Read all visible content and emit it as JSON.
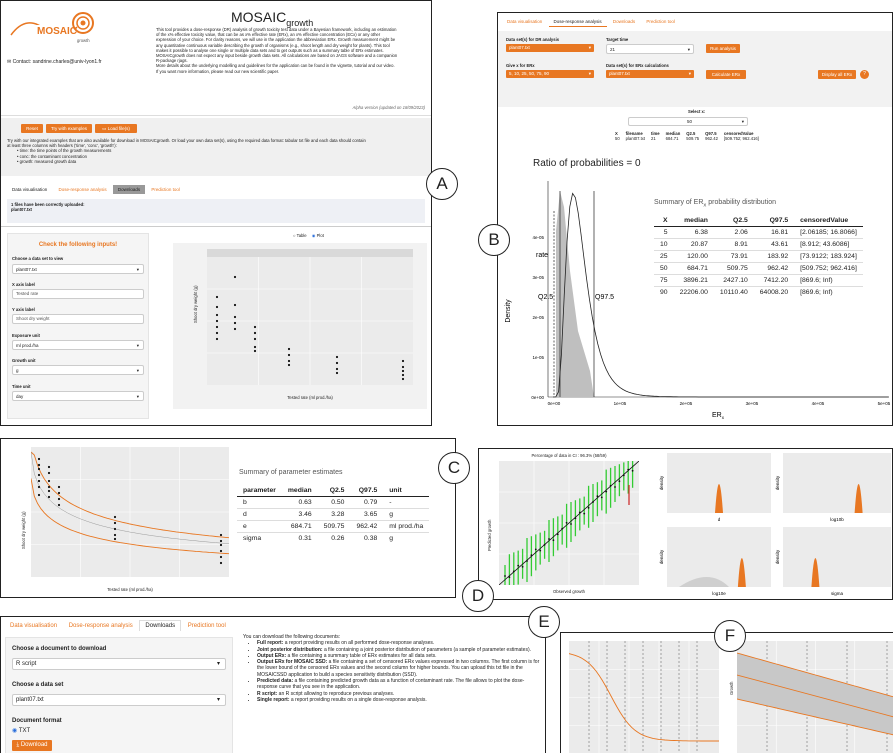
{
  "labels": {
    "a": "A",
    "b": "B",
    "c": "C",
    "d": "D",
    "e": "E",
    "f": "F"
  },
  "panelA": {
    "title": "MOSAIC",
    "title_sub": "growth",
    "logo_text": "MOSAIC",
    "logo_sub": "growth",
    "contact": "Contact: sandrine.charles@univ-lyon1.fr",
    "intro_lines": [
      "This tool provides a dose-response (DR) analysis of growth toxicity test data under a Bayesian framework, including an estimation",
      "of the x% effective toxicity value, that can be as x% effective rate (ERx), an x% effective concentration (ECx) or any other",
      "expression of your choice. For clarity reasons, we will use in the application the abbreviation ERx. Growth measurement might be",
      "any quantitative continuous variable describing the growth of organisms (e.g., shoot length and dry weight for plants). This tool",
      "makes it possible to analyse one single or multiple data sets and to get outputs such as a summary table of ERx estimates.",
      "MOSAICgrowth does not expect any input beside growth data sets. All calculations are based on JAGS software and a companion",
      "R-package rjags.",
      "More details about the underlying modelling and guidelines for the application can be found in the vignette, tutorial and our video.",
      "If you want more information, please read our new scientific paper."
    ],
    "version": "Alpha version (updated on 18/09/2023)",
    "btn_reset": "Reset",
    "btn_examples": "Try with examples",
    "btn_load": "Load file(s)",
    "desc_lines": [
      "Try with our integrated examples that are also available for download in MOSAICgrowth. Or load your own data set(s), using the required data format: tabular txt file and each data should contain",
      "at least three columns with headers ('time', 'conc', 'growth'):"
    ],
    "bullets": [
      "time: the time points of the growth measurements",
      "conc: the contaminant concentration",
      "growth: measured growth data"
    ],
    "tabs": [
      "Data visualisation",
      "Dose-response analysis",
      "Downloads",
      "Prediction tool"
    ],
    "upload_msg": "1 files have been correctly uploaded:",
    "upload_file": "plant07.txt",
    "check_title": "Check the following inputs!",
    "fields": [
      {
        "label": "Choose a data set to view",
        "value": "plant07.txt"
      },
      {
        "label": "X axis label",
        "value": "Tested rate"
      },
      {
        "label": "Y axis label",
        "value": "Shoot dry weight"
      },
      {
        "label": "Exposure unit",
        "value": "ml prod./ha"
      },
      {
        "label": "Growth unit",
        "value": "g"
      },
      {
        "label": "Time unit",
        "value": "day"
      }
    ],
    "radio_table": "Table",
    "radio_plot": "Plot",
    "plot_strip": "time 21 (day)",
    "plot_xlabel": "Tested rate (ml prod./ha)",
    "plot_ylabel": "Shoot dry weight (g)"
  },
  "panelB": {
    "tabs": [
      "Data visualisation",
      "Dose-response analysis",
      "Downloads",
      "Prediction tool"
    ],
    "ds_label": "Data set(s) for DR analysis",
    "ds_value": "plant07.txt",
    "target_label": "Target time",
    "target_value": "21",
    "run_btn": "Run analysis",
    "x_label": "Give x for ERx",
    "x_value": "5, 10, 25, 50, 75, 90",
    "ds2_label": "Data set(s) for ERx calculations",
    "ds2_value": "plant07.txt",
    "calc_btn": "Calculate ERx",
    "display_btn": "Display all ERx",
    "select_label": "Select x:",
    "select_value": "50",
    "mini_headers": [
      "X",
      "filename",
      "time",
      "median",
      "Q2.5",
      "Q97.5",
      "censoredValue"
    ],
    "mini_row": [
      "50",
      "plant07.txt",
      "21",
      "684.71",
      "509.75",
      "962.42",
      "[509.752; 962.416]"
    ],
    "plot_title": "Ratio of probabilities = 0",
    "rate_label": "rate",
    "q25_label": "Q2.5",
    "q975_label": "Q97.5",
    "ylabel": "Density",
    "xlabel": "ERx",
    "yticks": [
      "0e+00",
      "1e-05",
      "2e-05",
      "3e-05",
      "4e-05"
    ],
    "xticks": [
      "0e+00",
      "1e+05",
      "2e+05",
      "3e+05",
      "4e+05",
      "5e+05"
    ],
    "summary_title": "Summary of ERx probability distribution",
    "summary_headers": [
      "X",
      "median",
      "Q2.5",
      "Q97.5",
      "censoredValue"
    ],
    "summary_rows": [
      [
        "5",
        "6.38",
        "2.06",
        "16.81",
        "[2.06185; 16.8066]"
      ],
      [
        "10",
        "20.87",
        "8.91",
        "43.61",
        "[8.912; 43.6086]"
      ],
      [
        "25",
        "120.00",
        "73.91",
        "183.92",
        "[73.9122; 183.924]"
      ],
      [
        "50",
        "684.71",
        "509.75",
        "962.42",
        "[509.752; 962.416]"
      ],
      [
        "75",
        "3896.21",
        "2427.10",
        "7412.20",
        "[869.6; Inf)"
      ],
      [
        "90",
        "22206.00",
        "10110.40",
        "64008.20",
        "[869.6; Inf)"
      ]
    ]
  },
  "panelC": {
    "summary_title": "Summary of parameter estimates",
    "headers": [
      "parameter",
      "median",
      "Q2.5",
      "Q97.5",
      "unit"
    ],
    "rows": [
      [
        "b",
        "0.63",
        "0.50",
        "0.79",
        "-"
      ],
      [
        "d",
        "3.46",
        "3.28",
        "3.65",
        "g"
      ],
      [
        "e",
        "684.71",
        "509.75",
        "962.42",
        "ml prod./ha"
      ],
      [
        "sigma",
        "0.31",
        "0.26",
        "0.38",
        "g"
      ]
    ],
    "xlabel": "Tested rate (ml prod./ha)",
    "ylabel": "Shoot dry weight (g)"
  },
  "panelD": {
    "ppc_title": "Percentage of data in CI : 96.3% (58/59)",
    "ppc_xlabel": "Observed growth",
    "ppc_ylabel": "Predicted growth",
    "dens_ylabel": "density",
    "dens_xlabels": [
      "d",
      "log10b",
      "log10e",
      "sigma"
    ]
  },
  "panelE": {
    "tabs": [
      "Data visualisation",
      "Dose-response analysis",
      "Downloads",
      "Prediction tool"
    ],
    "doc_label": "Choose a document to download",
    "doc_value": "R script",
    "ds_label": "Choose a data set",
    "ds_value": "plant07.txt",
    "format_label": "Document format",
    "format_value": "TXT",
    "download_btn": "Download",
    "intro": "You can download the following documents:",
    "items": [
      {
        "b": "Full report:",
        "t": " a report providing results on all performed dose-response analyses."
      },
      {
        "b": "Joint posterior distribution:",
        "t": " a file containing a joint posterior distribution of parameters (a sample of parameter estimates)."
      },
      {
        "b": "Output ERx:",
        "t": " a file containing a summary table of ERx estimates for all data sets."
      },
      {
        "b": "Output ERx for MOSAIC SSD:",
        "t": " a file containing a set of censored ERx values expressed in two columns. The first column is for the lower bound of the censored ERx values and the second column for higher bounds. You can upload this txt file in the MOSAICSSD application to build a species sensitivity distribution (SSD)."
      },
      {
        "b": "Predicted data:",
        "t": " a file containing predicted growth data as a function of contaminant rate. The file allows to plot the dose-response curve that you see in the application."
      },
      {
        "b": "R script:",
        "t": " an R script allowing to reproduce previous analyses."
      },
      {
        "b": "Single report:",
        "t": " a report providing results on a single dose-response analysis."
      }
    ]
  },
  "panelF": {
    "ylabel": "Growth"
  },
  "colors": {
    "accent": "#e87722",
    "panel_border": "#222222",
    "plot_bg": "#ebebeb"
  }
}
